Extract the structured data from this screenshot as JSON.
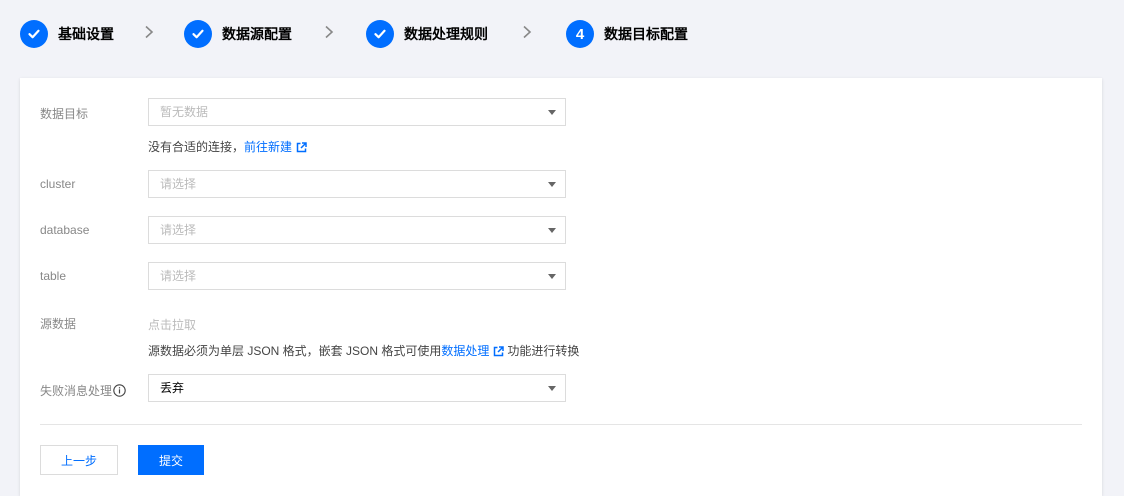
{
  "steps": [
    {
      "label": "基础设置",
      "status": "done"
    },
    {
      "label": "数据源配置",
      "status": "done"
    },
    {
      "label": "数据处理规则",
      "status": "done"
    },
    {
      "label": "数据目标配置",
      "status": "current",
      "number": "4"
    }
  ],
  "form": {
    "target": {
      "label": "数据目标",
      "value": "暂无数据",
      "hint_prefix": "没有合适的连接，",
      "hint_link": "前往新建"
    },
    "cluster": {
      "label": "cluster",
      "value": "请选择"
    },
    "database": {
      "label": "database",
      "value": "请选择"
    },
    "table": {
      "label": "table",
      "value": "请选择"
    },
    "source": {
      "label": "源数据",
      "value": "点击拉取",
      "hint_prefix": "源数据必须为单层 JSON 格式，嵌套 JSON 格式可使用",
      "hint_link": "数据处理",
      "hint_suffix": "功能进行转换"
    },
    "failure": {
      "label": "失败消息处理",
      "value": "丢弃"
    }
  },
  "buttons": {
    "prev": "上一步",
    "submit": "提交"
  },
  "colors": {
    "accent": "#006eff",
    "background": "#f2f3f8"
  }
}
